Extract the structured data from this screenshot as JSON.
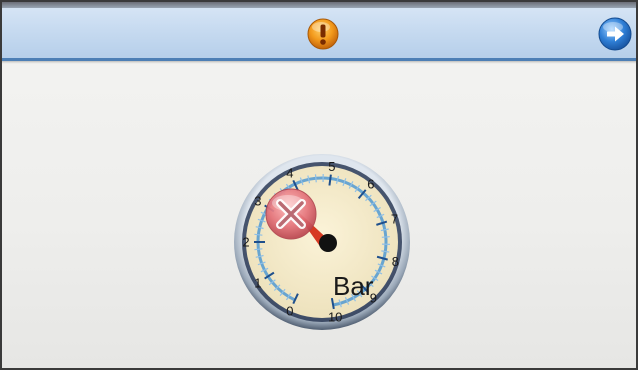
{
  "toolbar": {
    "alert_icon": "exclamation-icon",
    "next_icon": "right-arrow-icon",
    "accent": "#4d7fb5"
  },
  "gauge": {
    "unit": "Bar",
    "min": 0,
    "max": 10,
    "value": 3.5,
    "ticks": [
      "0",
      "1",
      "2",
      "3",
      "4",
      "5",
      "6",
      "7",
      "8",
      "9",
      "10"
    ],
    "status_icon": "close-icon",
    "needle_color": "#d63a22",
    "scale_color": "#3b8fd4"
  }
}
